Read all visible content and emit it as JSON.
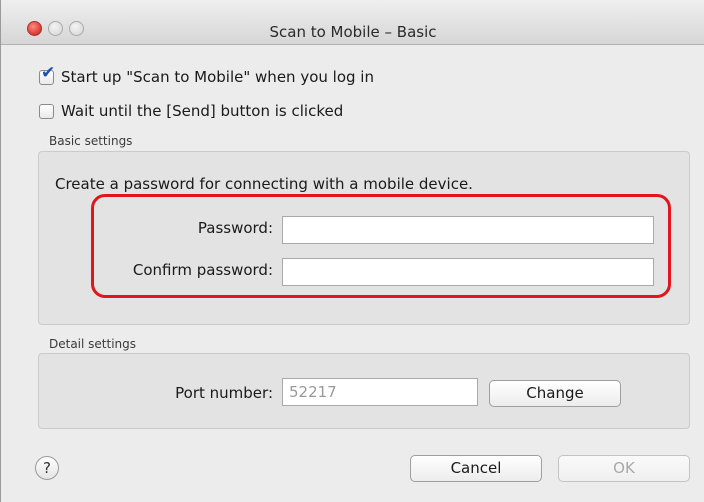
{
  "window": {
    "title": "Scan to Mobile – Basic"
  },
  "options": {
    "startup": {
      "label": "Start up \"Scan to Mobile\" when you log in",
      "checked": true
    },
    "wait_send": {
      "label": "Wait until the [Send] button is clicked",
      "checked": false
    }
  },
  "basic": {
    "group_label": "Basic settings",
    "description": "Create a password for connecting with a mobile device.",
    "password_label": "Password:",
    "password_value": "",
    "confirm_label": "Confirm password:",
    "confirm_value": ""
  },
  "detail": {
    "group_label": "Detail settings",
    "port_label": "Port number:",
    "port_value": "52217",
    "change_button": "Change"
  },
  "footer": {
    "help_symbol": "?",
    "cancel_button": "Cancel",
    "ok_button": "OK"
  },
  "colors": {
    "highlight": "#e4141b",
    "checkmark": "#1c4fb8"
  }
}
